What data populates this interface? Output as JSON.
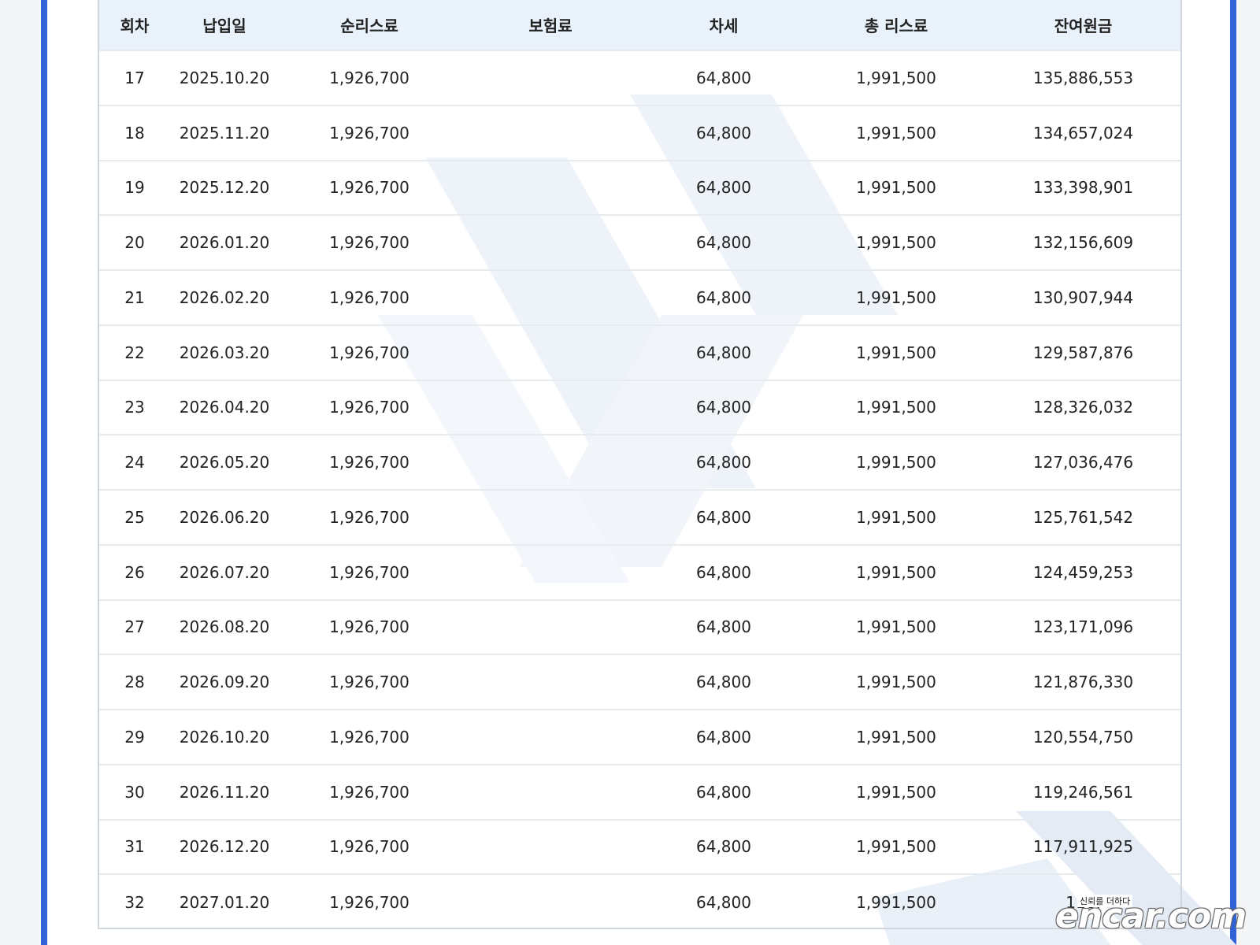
{
  "table": {
    "headers": [
      "회차",
      "납입일",
      "순리스료",
      "보험료",
      "차세",
      "총 리스료",
      "잔여원금"
    ],
    "rows": [
      [
        "17",
        "2025.10.20",
        "1,926,700",
        "",
        "64,800",
        "1,991,500",
        "135,886,553"
      ],
      [
        "18",
        "2025.11.20",
        "1,926,700",
        "",
        "64,800",
        "1,991,500",
        "134,657,024"
      ],
      [
        "19",
        "2025.12.20",
        "1,926,700",
        "",
        "64,800",
        "1,991,500",
        "133,398,901"
      ],
      [
        "20",
        "2026.01.20",
        "1,926,700",
        "",
        "64,800",
        "1,991,500",
        "132,156,609"
      ],
      [
        "21",
        "2026.02.20",
        "1,926,700",
        "",
        "64,800",
        "1,991,500",
        "130,907,944"
      ],
      [
        "22",
        "2026.03.20",
        "1,926,700",
        "",
        "64,800",
        "1,991,500",
        "129,587,876"
      ],
      [
        "23",
        "2026.04.20",
        "1,926,700",
        "",
        "64,800",
        "1,991,500",
        "128,326,032"
      ],
      [
        "24",
        "2026.05.20",
        "1,926,700",
        "",
        "64,800",
        "1,991,500",
        "127,036,476"
      ],
      [
        "25",
        "2026.06.20",
        "1,926,700",
        "",
        "64,800",
        "1,991,500",
        "125,761,542"
      ],
      [
        "26",
        "2026.07.20",
        "1,926,700",
        "",
        "64,800",
        "1,991,500",
        "124,459,253"
      ],
      [
        "27",
        "2026.08.20",
        "1,926,700",
        "",
        "64,800",
        "1,991,500",
        "123,171,096"
      ],
      [
        "28",
        "2026.09.20",
        "1,926,700",
        "",
        "64,800",
        "1,991,500",
        "121,876,330"
      ],
      [
        "29",
        "2026.10.20",
        "1,926,700",
        "",
        "64,800",
        "1,991,500",
        "120,554,750"
      ],
      [
        "30",
        "2026.11.20",
        "1,926,700",
        "",
        "64,800",
        "1,991,500",
        "119,246,561"
      ],
      [
        "31",
        "2026.12.20",
        "1,926,700",
        "",
        "64,800",
        "1,991,500",
        "117,911,925"
      ],
      [
        "32",
        "2027.01.20",
        "1,926,700",
        "",
        "64,800",
        "1,991,500",
        "116,"
      ]
    ]
  },
  "watermark": {
    "brand": "encar.com",
    "tagline": "신뢰를 더하다"
  },
  "colors": {
    "frame": "#2f63d6",
    "header_bg": "#e9f2fb",
    "watermark": "#eef3f9"
  }
}
